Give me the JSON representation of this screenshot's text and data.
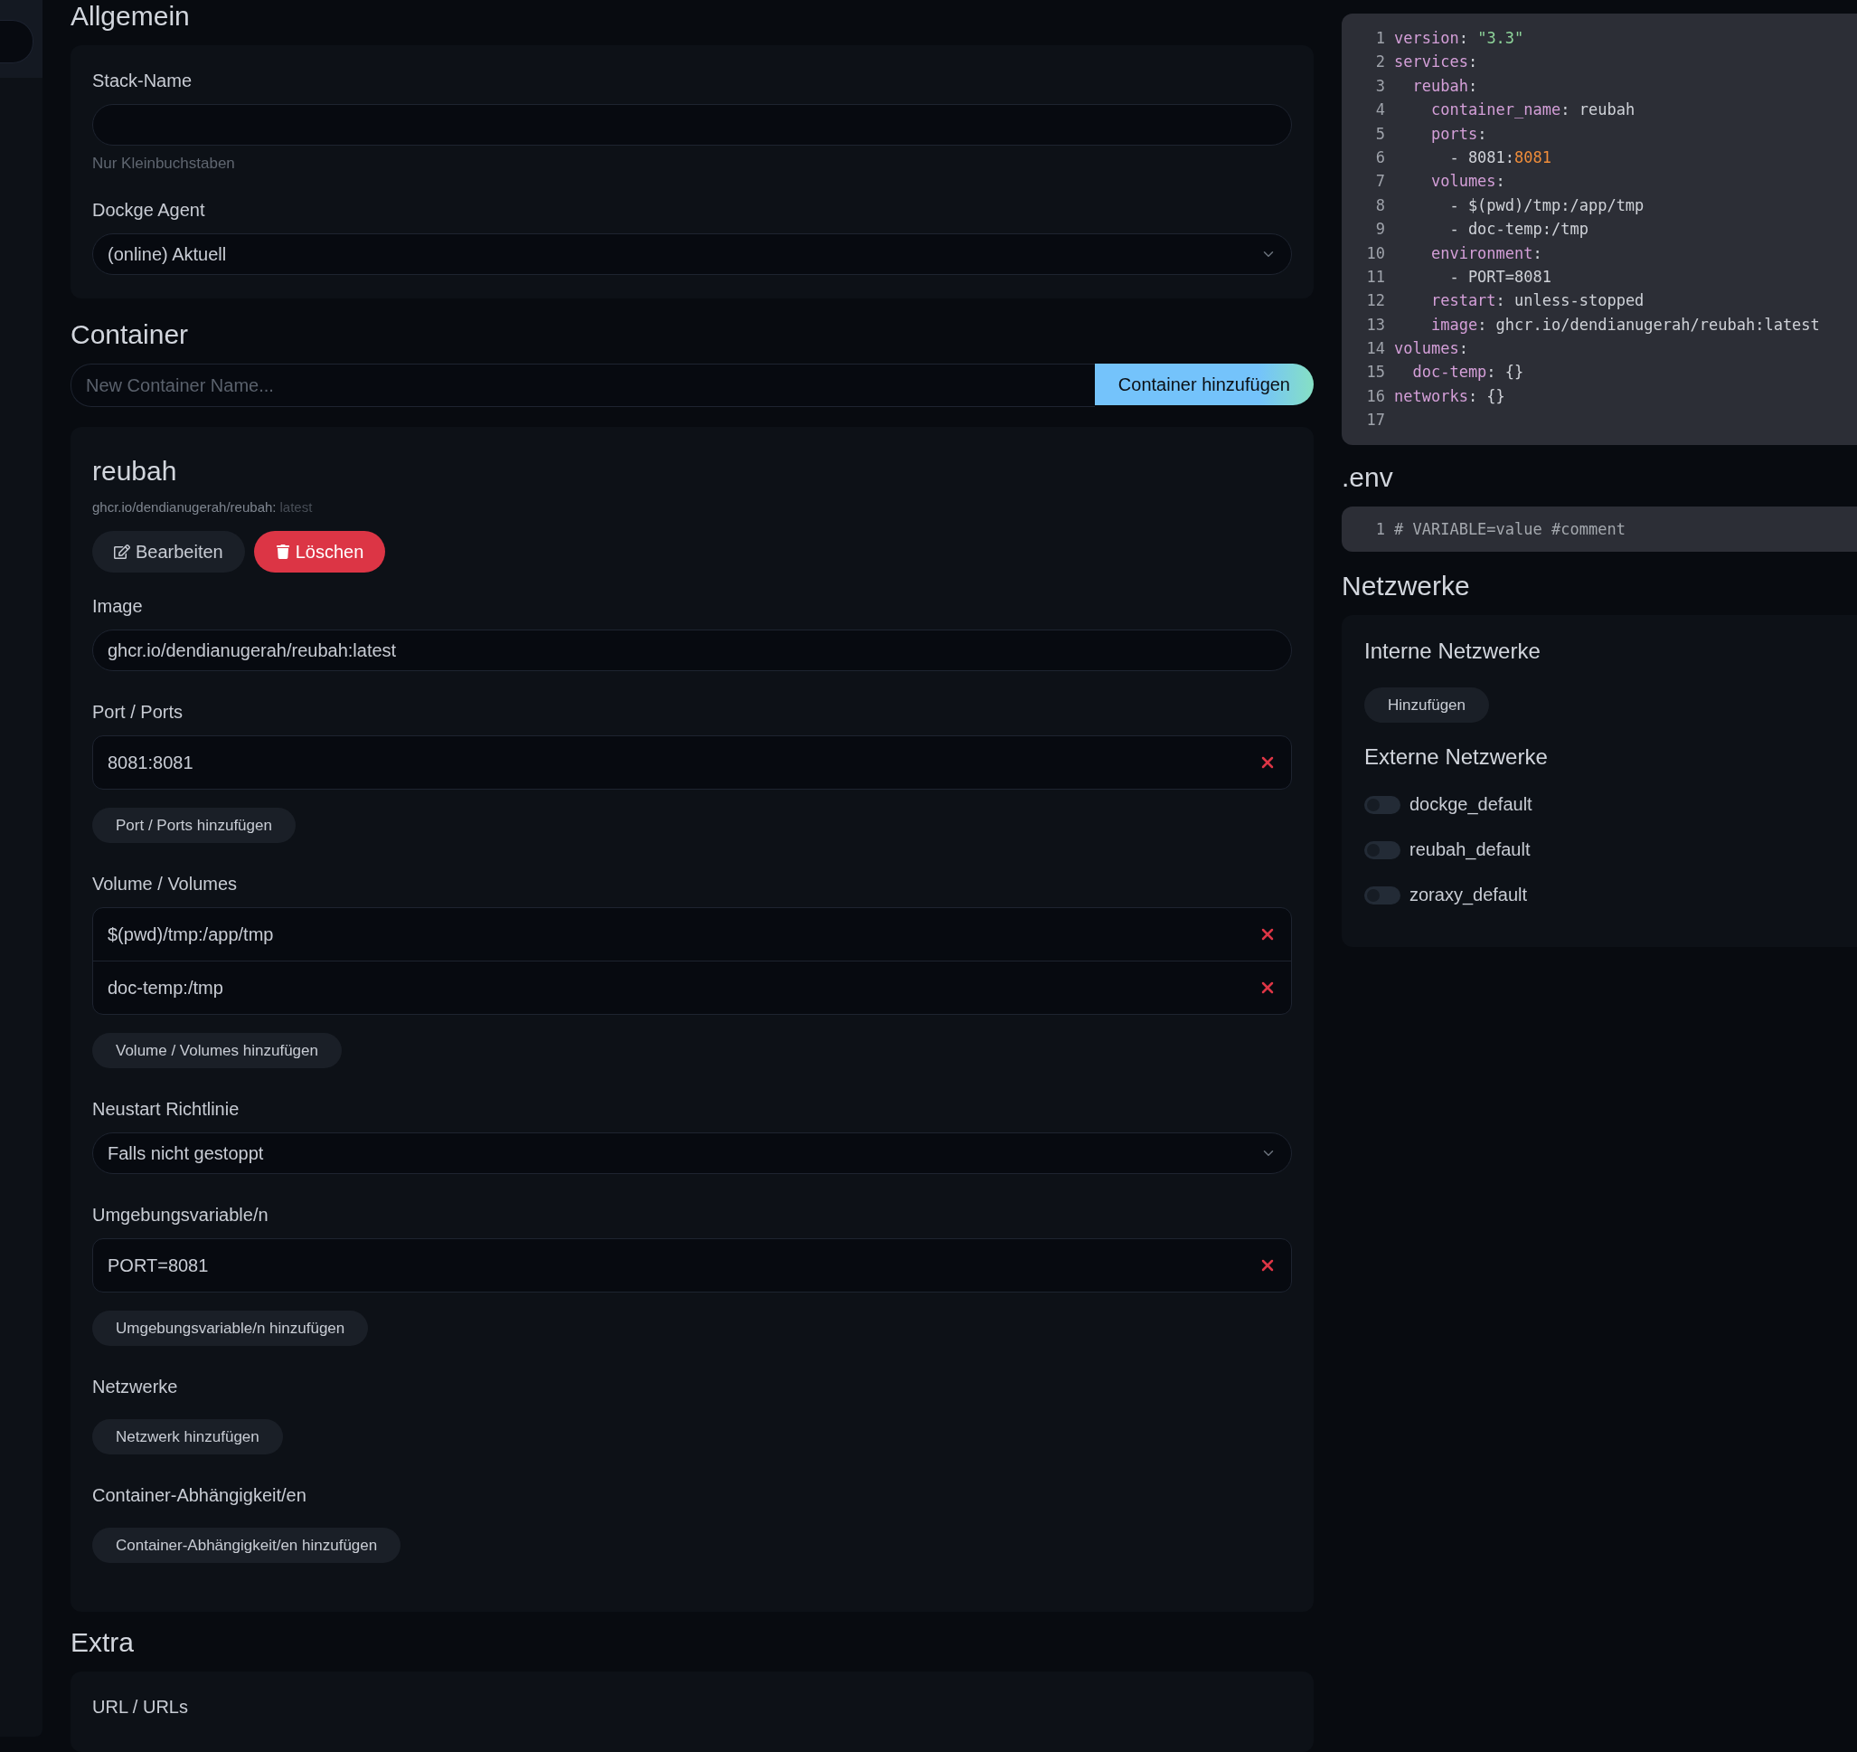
{
  "general": {
    "title": "Allgemein",
    "stack_name": {
      "label": "Stack-Name",
      "hint": "Nur Kleinbuchstaben"
    },
    "agent": {
      "label": "Dockge Agent",
      "value": "(online) Aktuell"
    }
  },
  "containers": {
    "title": "Container",
    "new_name": {
      "placeholder": "New Container Name..."
    },
    "add_button": "Container hinzufügen",
    "items": [
      {
        "name": "reubah",
        "image_name": "ghcr.io/dendianugerah/reubah:",
        "tag": "latest",
        "edit_button": "Bearbeiten",
        "delete_button": "Löschen",
        "sections": [
          {
            "kind": "input",
            "label": "Image",
            "value": "ghcr.io/dendianugerah/reubah:latest"
          },
          {
            "kind": "list",
            "label": "Port / Ports",
            "values": [
              "8081:8081"
            ],
            "add_button": "Port / Ports hinzufügen"
          },
          {
            "kind": "list",
            "label": "Volume / Volumes",
            "values": [
              "$(pwd)/tmp:/app/tmp",
              "doc-temp:/tmp"
            ],
            "add_button": "Volume / Volumes hinzufügen"
          },
          {
            "kind": "select",
            "label": "Neustart Richtlinie",
            "value": "Falls nicht gestoppt"
          },
          {
            "kind": "list",
            "label": "Umgebungsvariable/n",
            "values": [
              "PORT=8081"
            ],
            "add_button": "Umgebungsvariable/n hinzufügen"
          },
          {
            "kind": "list",
            "label": "Netzwerke",
            "add_button": "Netzwerk hinzufügen"
          },
          {
            "kind": "list",
            "label": "Container-Abhängigkeit/en",
            "add_button": "Container-Abhängigkeit/en hinzufügen"
          }
        ]
      }
    ]
  },
  "extra": {
    "title": "Extra",
    "fields": [
      {
        "label": "URL / URLs"
      }
    ]
  },
  "compose": {
    "lines": [
      {
        "number": "1",
        "tokens": [
          {
            "text": "version",
            "kind": "key"
          },
          {
            "text": ": ",
            "kind": "plain"
          },
          {
            "text": "\"3.3\"",
            "kind": "string"
          }
        ]
      },
      {
        "number": "2",
        "tokens": [
          {
            "text": "services",
            "kind": "key"
          },
          {
            "text": ":",
            "kind": "plain"
          }
        ]
      },
      {
        "number": "3",
        "tokens": [
          {
            "text": "  reubah",
            "kind": "key"
          },
          {
            "text": ":",
            "kind": "plain"
          }
        ]
      },
      {
        "number": "4",
        "tokens": [
          {
            "text": "    container_name",
            "kind": "key"
          },
          {
            "text": ": reubah",
            "kind": "plain"
          }
        ]
      },
      {
        "number": "5",
        "tokens": [
          {
            "text": "    ports",
            "kind": "key"
          },
          {
            "text": ":",
            "kind": "plain"
          }
        ]
      },
      {
        "number": "6",
        "tokens": [
          {
            "text": "      - 8081:",
            "kind": "plain"
          },
          {
            "text": "8081",
            "kind": "number"
          }
        ]
      },
      {
        "number": "7",
        "tokens": [
          {
            "text": "    volumes",
            "kind": "key"
          },
          {
            "text": ":",
            "kind": "plain"
          }
        ]
      },
      {
        "number": "8",
        "tokens": [
          {
            "text": "      - $(pwd)/tmp:/app/tmp",
            "kind": "plain"
          }
        ]
      },
      {
        "number": "9",
        "tokens": [
          {
            "text": "      - doc-temp:/tmp",
            "kind": "plain"
          }
        ]
      },
      {
        "number": "10",
        "tokens": [
          {
            "text": "    environment",
            "kind": "key"
          },
          {
            "text": ":",
            "kind": "plain"
          }
        ]
      },
      {
        "number": "11",
        "tokens": [
          {
            "text": "      - PORT=8081",
            "kind": "plain"
          }
        ]
      },
      {
        "number": "12",
        "tokens": [
          {
            "text": "    restart",
            "kind": "key"
          },
          {
            "text": ": unless-stopped",
            "kind": "plain"
          }
        ]
      },
      {
        "number": "13",
        "tokens": [
          {
            "text": "    image",
            "kind": "key"
          },
          {
            "text": ": ghcr.io/dendianugerah/reubah:latest",
            "kind": "plain"
          }
        ]
      },
      {
        "number": "14",
        "tokens": [
          {
            "text": "volumes",
            "kind": "key"
          },
          {
            "text": ":",
            "kind": "plain"
          }
        ]
      },
      {
        "number": "15",
        "tokens": [
          {
            "text": "  doc-temp",
            "kind": "key"
          },
          {
            "text": ": {}",
            "kind": "plain"
          }
        ]
      },
      {
        "number": "16",
        "tokens": [
          {
            "text": "networks",
            "kind": "key"
          },
          {
            "text": ": {}",
            "kind": "plain"
          }
        ]
      },
      {
        "number": "17"
      }
    ]
  },
  "env": {
    "title": ".env",
    "lines": [
      {
        "number": "1",
        "tokens": [
          {
            "text": "# VARIABLE=value #comment",
            "kind": "comment"
          }
        ]
      }
    ]
  },
  "networks": {
    "title": "Netzwerke",
    "internal": {
      "title": "Interne Netzwerke",
      "add_button": "Hinzufügen"
    },
    "external": {
      "title": "Externe Netzwerke",
      "items": [
        {
          "name": "dockge_default",
          "on": false
        },
        {
          "name": "reubah_default",
          "on": false
        },
        {
          "name": "zoraxy_default",
          "on": false
        }
      ]
    }
  }
}
